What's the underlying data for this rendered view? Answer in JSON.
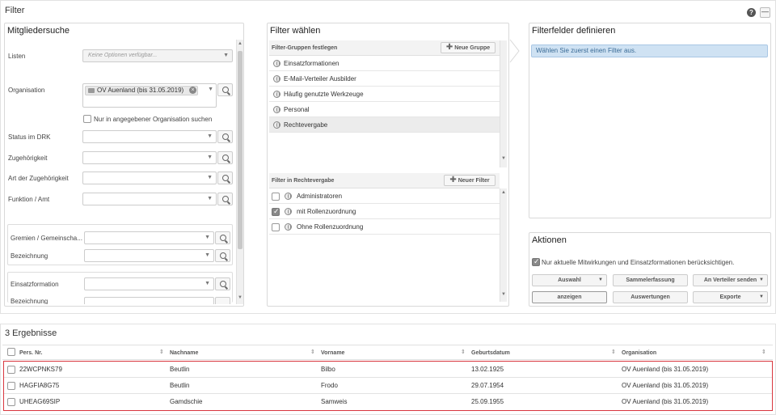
{
  "filter": {
    "title": "Filter",
    "help_icon": "?",
    "minimize_icon": "—"
  },
  "mitgliedersuche": {
    "heading": "Mitgliedersuche",
    "listen_label": "Listen",
    "listen_placeholder": "Keine Optionen verfügbar...",
    "organisation_label": "Organisation",
    "organisation_tag": "OV Auenland (bis 31.05.2019)",
    "nur_org_label": "Nur in angegebener Organisation suchen",
    "status_label": "Status im DRK",
    "zugehoerigkeit_label": "Zugehörigkeit",
    "art_label": "Art der Zugehörigkeit",
    "funktion_label": "Funktion / Amt",
    "gremien_label": "Gremien / Gemeinscha...",
    "bezeichnung1_label": "Bezeichnung",
    "einsatzformation_label": "Einsatzformation",
    "bezeichnung2_label": "Bezeichnung"
  },
  "filter_waehlen": {
    "heading": "Filter wählen",
    "groups_header": "Filter-Gruppen festlegen",
    "new_group_button": "Neue Gruppe",
    "groups": [
      {
        "label": "Einsatzformationen"
      },
      {
        "label": "E-Mail-Verteiler Ausbilder"
      },
      {
        "label": "Häufig genutzte Werkzeuge"
      },
      {
        "label": "Personal"
      },
      {
        "label": "Rechtevergabe"
      }
    ],
    "filters_header": "Filter in Rechtevergabe",
    "new_filter_button": "Neuer Filter",
    "filters": [
      {
        "label": "Administratoren",
        "checked": false
      },
      {
        "label": "mit Rollenzuordnung",
        "checked": true
      },
      {
        "label": "Ohne Rollenzuordnung",
        "checked": false
      }
    ]
  },
  "filterfelder": {
    "heading": "Filterfelder definieren",
    "info": "Wählen Sie zuerst einen Filter aus."
  },
  "aktionen": {
    "heading": "Aktionen",
    "checkbox_label": "Nur aktuelle Mitwirkungen und Einsatzformationen berücksichtigen.",
    "buttons": {
      "auswahl": "Auswahl",
      "sammelerfassung": "Sammelerfassung",
      "verteiler": "An Verteiler senden",
      "anzeigen": "anzeigen",
      "auswertungen": "Auswertungen",
      "exporte": "Exporte"
    }
  },
  "results": {
    "title": "3 Ergebnisse",
    "columns": [
      "Pers. Nr.",
      "Nachname",
      "Vorname",
      "Geburtsdatum",
      "Organisation"
    ],
    "rows": [
      [
        "22WCPNKS79",
        "Beutlin",
        "Bilbo",
        "13.02.1925",
        "OV Auenland (bis 31.05.2019)"
      ],
      [
        "HAGFIA8G75",
        "Beutlin",
        "Frodo",
        "29.07.1954",
        "OV Auenland (bis 31.05.2019)"
      ],
      [
        "UHEAG69SIP",
        "Gamdschie",
        "Samweis",
        "25.09.1955",
        "OV Auenland (bis 31.05.2019)"
      ]
    ]
  }
}
